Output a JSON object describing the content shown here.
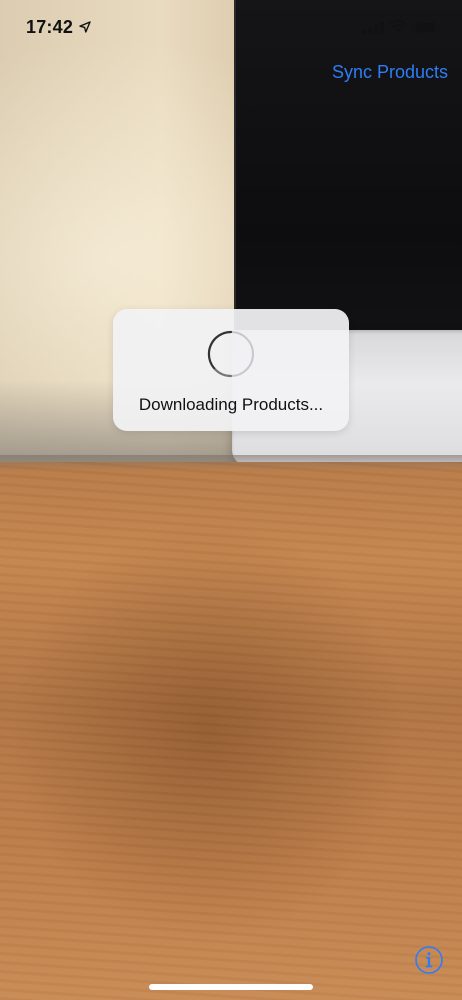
{
  "status_bar": {
    "time": "17:42",
    "icons": [
      "location-arrow-icon",
      "cellular-signal-icon",
      "wifi-icon",
      "battery-icon"
    ]
  },
  "nav": {
    "sync_label": "Sync Products"
  },
  "hud": {
    "label": "Downloading Products...",
    "icon": "activity-spinner-icon"
  },
  "bottom": {
    "info_icon": "info-icon"
  },
  "colors": {
    "accent": "#2f7df6",
    "hud_background": "#f2f2f4",
    "text": "#111111"
  }
}
